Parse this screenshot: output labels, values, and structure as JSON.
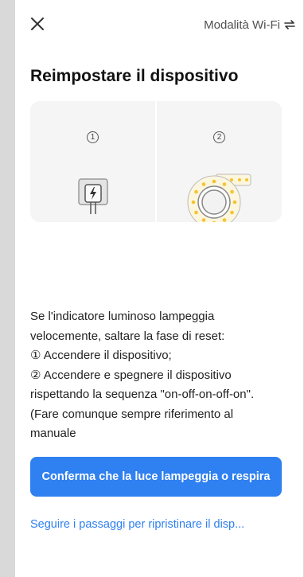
{
  "topbar": {
    "close_icon": "close-icon",
    "mode_label": "Modalità Wi-Fi",
    "mode_icon": "swap-arrows-icon"
  },
  "title": "Reimpostare il dispositivo",
  "steps": [
    {
      "number": "1",
      "image": "power-plug-icon"
    },
    {
      "number": "2",
      "image": "light-strip-coil-icon"
    }
  ],
  "instructions": {
    "intro": "Se l'indicatore luminoso lampeggia velocemente, saltare la fase di reset:",
    "step1": "① Accendere il dispositivo;",
    "step2": "② Accendere e spegnere il dispositivo rispettando la sequenza \"on-off-on-off-on\". (Fare comunque sempre riferimento al manuale"
  },
  "confirm_button": "Conferma che la luce lampeggia o respira",
  "reset_link": "Seguire i passaggi per ripristinare il disp...",
  "colors": {
    "accent": "#2f80f0",
    "led": "#f4c430"
  }
}
